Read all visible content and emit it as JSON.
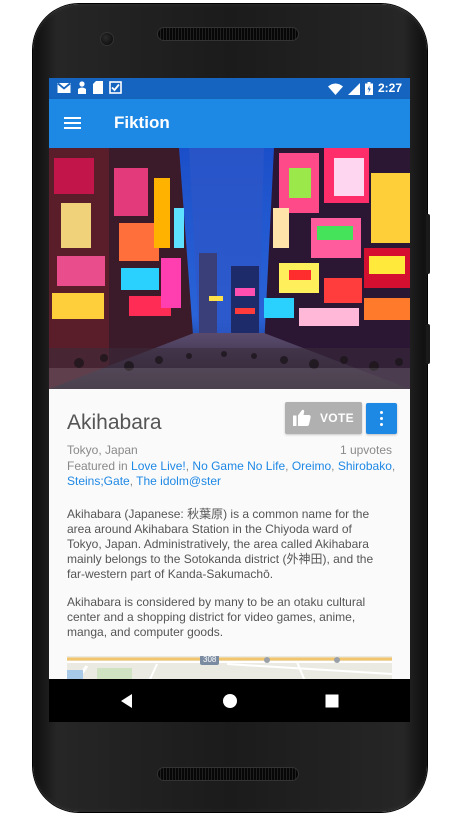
{
  "status_bar": {
    "time": "2:27",
    "left_icons": [
      "gmail-icon",
      "person-icon",
      "sd-card-icon",
      "checkbox-icon"
    ],
    "right_icons": [
      "wifi-icon",
      "signal-icon",
      "battery-icon"
    ]
  },
  "app_bar": {
    "title": "Fiktion",
    "menu_icon": "hamburger-menu-icon"
  },
  "hero": {
    "icon": "tokyo-street-neon-photo"
  },
  "place": {
    "name": "Akihabara",
    "location": "Tokyo, Japan",
    "upvotes": "1 upvotes",
    "vote_label": "VOTE",
    "featured_prefix": "Featured in ",
    "featured_works": [
      "Love Live!",
      "No Game No Life",
      "Oreimo",
      "Shirobako",
      "Steins;Gate",
      "The idolm@ster"
    ],
    "description_1": "Akihabara (Japanese: 秋葉原) is a common name for the area around Akihabara Station in the Chiyoda ward of Tokyo, Japan. Administratively, the area called Akihabara mainly belongs to the Sotokanda district (外神田), and the far-western part of Kanda-Sakumachō.",
    "description_2": "Akihabara is considered by many to be an otaku cultural center and a shopping district for video games, anime, manga, and computer goods."
  },
  "map": {
    "road_label": "308"
  },
  "colors": {
    "primary": "#1e88e5",
    "status": "#1565c0",
    "vote_grey": "#b0b0b0",
    "link": "#1e88e5"
  },
  "nav_bar": {
    "icons": [
      "back-icon",
      "home-icon",
      "recents-icon"
    ]
  }
}
